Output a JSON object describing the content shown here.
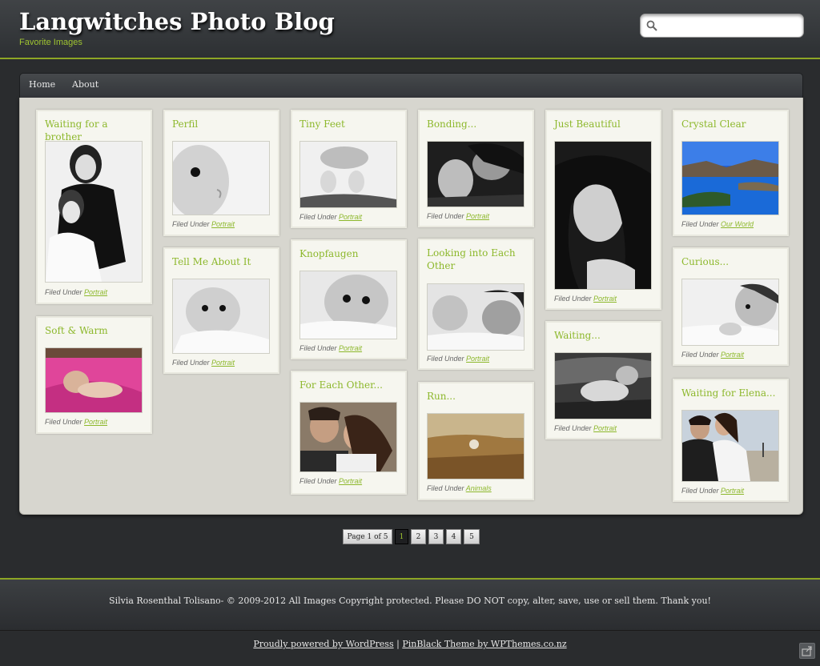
{
  "header": {
    "title": "Langwitches Photo Blog",
    "description": "Favorite Images",
    "search_placeholder": ""
  },
  "nav": {
    "items": [
      "Home",
      "About"
    ]
  },
  "posts": [
    {
      "title": "Waiting for a brother",
      "category": "Portrait"
    },
    {
      "title": "Soft & Warm",
      "category": "Portrait"
    },
    {
      "title": "Perfil",
      "category": "Portrait"
    },
    {
      "title": "Tell Me About It",
      "category": "Portrait"
    },
    {
      "title": "Tiny Feet",
      "category": "Portrait"
    },
    {
      "title": "Knopfaugen",
      "category": "Portrait"
    },
    {
      "title": "For Each Other...",
      "category": "Portrait"
    },
    {
      "title": "Bonding...",
      "category": "Portrait"
    },
    {
      "title": "Looking into Each Other",
      "category": "Portrait"
    },
    {
      "title": "Run...",
      "category": "Animals"
    },
    {
      "title": "Just Beautiful",
      "category": "Portrait"
    },
    {
      "title": "Waiting...",
      "category": "Portrait"
    },
    {
      "title": "Crystal Clear",
      "category": "Our World"
    },
    {
      "title": "Curious...",
      "category": "Portrait"
    },
    {
      "title": "Waiting for Elena...",
      "category": "Portrait"
    }
  ],
  "filed_under_label": "Filed Under",
  "pagination": {
    "label": "Page 1 of 5",
    "pages": [
      "1",
      "2",
      "3",
      "4",
      "5"
    ],
    "current": "1"
  },
  "footer": {
    "copyright": "Silvia Rosenthal Tolisano- © 2009-2012 All Images Copyright protected. Please DO NOT copy, alter, save, use or sell them. Thank you!",
    "powered": "Proudly powered by WordPress",
    "separator": "|",
    "theme": "PinBlack Theme by WPThemes.co.nz"
  },
  "colors": {
    "accent": "#8db82c",
    "background": "#2a2c2e",
    "content_bg": "#d7d6cf",
    "card_bg": "#f6f6ef"
  }
}
